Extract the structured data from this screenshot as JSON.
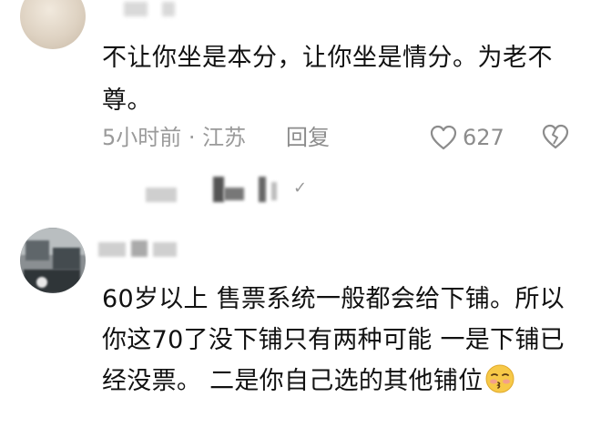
{
  "comment1": {
    "text": "不让你坐是本分，让你坐是情分。为老不尊。",
    "time_location": "5小时前 · 江苏",
    "reply_label": "回复",
    "like_count": "627",
    "icons": {
      "like": "heart-outline-icon",
      "dislike": "broken-heart-icon"
    }
  },
  "reply_preview": {
    "icons": {
      "expand": "chevron-check-icon"
    }
  },
  "comment2": {
    "text": "60岁以上 售票系统一般都会给下铺。所以你这70了没下铺只有两种可能  一是下铺已经没票。 二是你自己选的其他铺位",
    "emoji": "kissing-face-emoji"
  }
}
